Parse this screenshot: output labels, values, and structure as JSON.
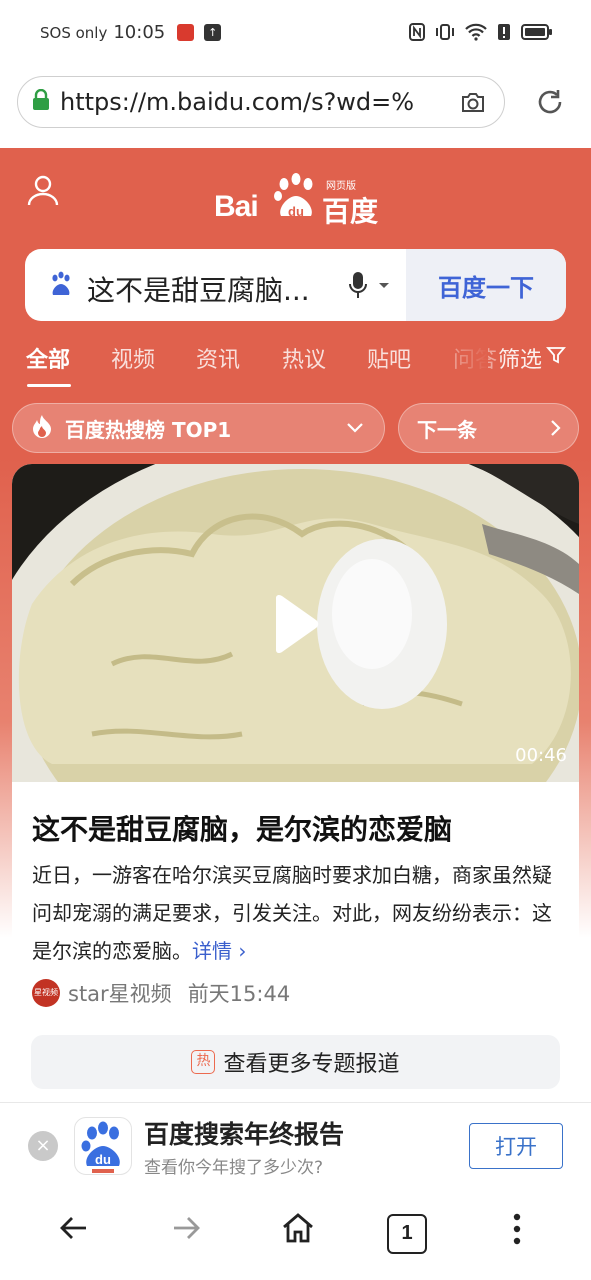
{
  "status_bar": {
    "carrier": "SOS only",
    "time": "10:05"
  },
  "address_bar": {
    "url": "https://m.baidu.com/s?wd=%"
  },
  "header": {
    "logo_text": "Bai",
    "logo_du": "du",
    "logo_cn": "百度",
    "logo_sub": "网页版",
    "search_query": "这不是甜豆腐脑...",
    "search_button": "百度一下",
    "tabs": [
      {
        "label": "全部",
        "active": true
      },
      {
        "label": "视频"
      },
      {
        "label": "资讯"
      },
      {
        "label": "热议"
      },
      {
        "label": "贴吧"
      },
      {
        "label": "问答"
      }
    ],
    "filter_label": "筛选",
    "hot_label": "百度热搜榜 TOP1",
    "next_label": "下一条"
  },
  "card": {
    "duration": "00:46",
    "title": "这不是甜豆腐脑，是尔滨的恋爱脑",
    "description": "近日，一游客在哈尔滨买豆腐脑时要求加白糖，商家虽然疑问却宠溺的满足要求，引发关注。对此，网友纷纷表示：这是尔滨的恋爱脑。",
    "more_link": "详情",
    "source_name": "star星视频",
    "source_time": "前天15:44",
    "source_icon_text": "星视频",
    "more_topics_tag": "热",
    "more_topics_label": "查看更多专题报道"
  },
  "banner": {
    "title": "百度搜索年终报告",
    "subtitle": "查看你今年搜了多少次?",
    "open_button": "打开",
    "close_symbol": "×"
  },
  "bottom_nav": {
    "tab_count": "1"
  },
  "colors": {
    "brand": "#e0614d",
    "link": "#3a5fcd",
    "accent_blue": "#3f64d6"
  },
  "icons": [
    "lock-icon",
    "camera-icon",
    "reload-icon",
    "user-icon",
    "paw-icon",
    "mic-icon",
    "filter-icon",
    "flame-icon",
    "chevron-down-icon",
    "chevron-right-icon",
    "play-icon",
    "close-icon",
    "back-icon",
    "forward-icon",
    "home-icon",
    "more-icon"
  ]
}
